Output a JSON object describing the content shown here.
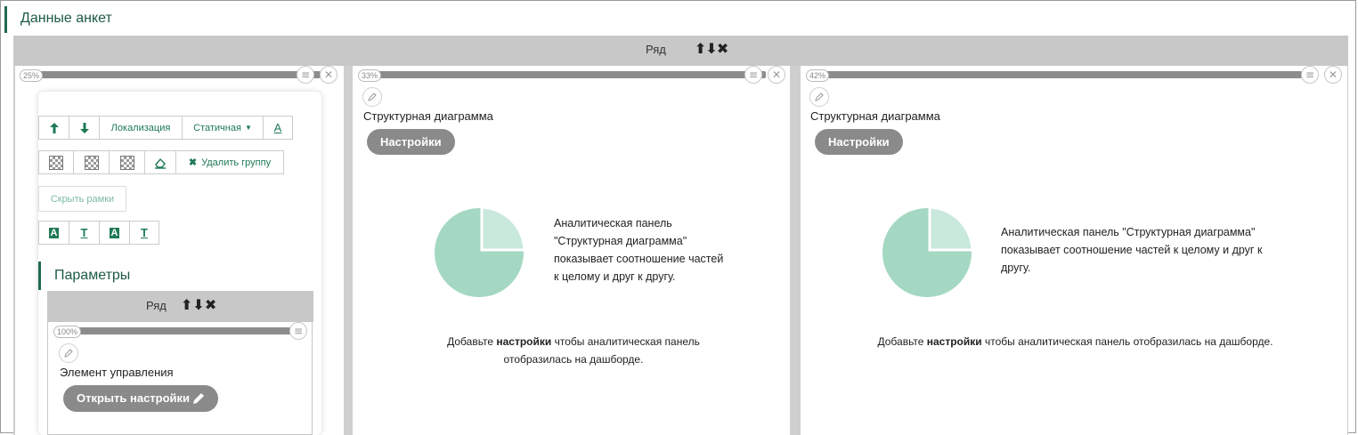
{
  "page_title": "Данные анкет",
  "row": {
    "label": "Ряд",
    "arrows": "⬆⬇✖"
  },
  "columns": [
    {
      "percent": "25%"
    },
    {
      "percent": "33%",
      "widget_title": "Структурная диаграмма",
      "settings_label": "Настройки",
      "desc_lines": [
        "Аналитическая панель",
        "\"Структурная диаграмма\"",
        "показывает соотношение частей",
        "к целому и друг к другу."
      ],
      "hint_before": "Добавьте ",
      "hint_bold": "настройки",
      "hint_after": " чтобы аналитическая панель",
      "hint_line2": "отобразилась на дашборде."
    },
    {
      "percent": "42%",
      "widget_title": "Структурная диаграмма",
      "settings_label": "Настройки",
      "desc_lines": [
        "Аналитическая панель \"Структурная диаграмма\"",
        "показывает соотношение частей к целому и друг к",
        "другу."
      ],
      "hint_before": "Добавьте ",
      "hint_bold": "настройки",
      "hint_after": " чтобы аналитическая панель отобразилась на дашборде.",
      "hint_line2": ""
    }
  ],
  "toolbar": {
    "localization": "Локализация",
    "static": "Статичная",
    "delete_group": "Удалить группу",
    "hide_frames": "Скрыть рамки"
  },
  "params": {
    "title": "Параметры",
    "row_label": "Ряд",
    "row_arrows": "⬆⬇✖",
    "percent": "100%",
    "element_title": "Элемент управления",
    "open_settings": "Открыть настройки"
  },
  "colors": {
    "accent": "#1e6b4f",
    "pie_main": "#a4d8c2",
    "pie_slice": "#c8e9dc",
    "bar": "#c8c8c8"
  },
  "pie": {
    "slice_fraction": 0.25
  }
}
